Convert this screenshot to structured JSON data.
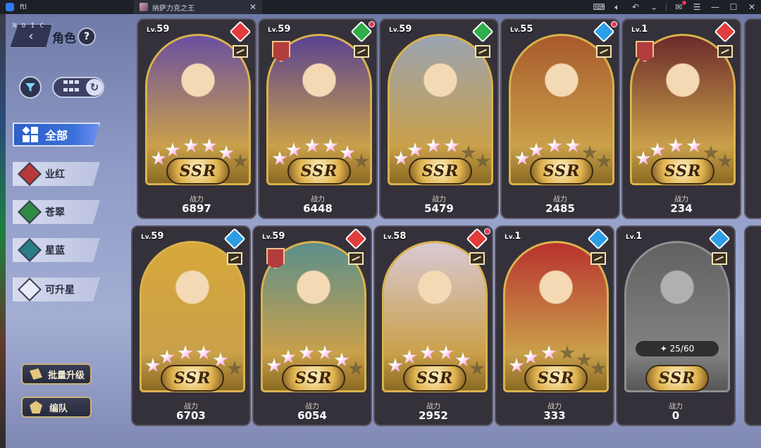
{
  "titlebar": {
    "tab1_label": "ftl",
    "tab2_label": "纳萨力克之王",
    "close_glyph": "✕"
  },
  "sidebar": {
    "back_deco": "N O I C",
    "title": "角色",
    "help": "?",
    "categories": [
      {
        "label": "全部",
        "color": "#ffffff"
      },
      {
        "label": "业红",
        "color": "#b63a3a"
      },
      {
        "label": "苍翠",
        "color": "#2f8a43"
      },
      {
        "label": "星蓝",
        "color": "#2a7c86"
      },
      {
        "label": "可升星",
        "color": "#3b3f55"
      }
    ],
    "batch_upgrade": "批量升级",
    "formation": "编队"
  },
  "cards": [
    {
      "lv": "59",
      "power_label": "战力",
      "power": "6897",
      "element": "#e23c3c",
      "stars_on": 5,
      "red_dot": false,
      "faction": false,
      "bg": "#6a4fa0"
    },
    {
      "lv": "59",
      "power_label": "战力",
      "power": "6448",
      "element": "#2fae4a",
      "stars_on": 5,
      "red_dot": true,
      "faction": true,
      "bg": "#5a4290"
    },
    {
      "lv": "59",
      "power_label": "战力",
      "power": "5479",
      "element": "#2fae4a",
      "stars_on": 4,
      "red_dot": false,
      "faction": false,
      "bg": "#9aa4b2"
    },
    {
      "lv": "55",
      "power_label": "战力",
      "power": "2485",
      "element": "#2c9ee6",
      "stars_on": 4,
      "red_dot": true,
      "faction": false,
      "bg": "#a85a2c"
    },
    {
      "lv": "1",
      "power_label": "战力",
      "power": "234",
      "element": "#e23c3c",
      "stars_on": 4,
      "red_dot": false,
      "faction": true,
      "bg": "#6b2a2a"
    },
    {
      "lv": "59",
      "power_label": "战力",
      "power": "6703",
      "element": "#2c9ee6",
      "stars_on": 5,
      "red_dot": false,
      "faction": false,
      "bg": "#d7a83a"
    },
    {
      "lv": "59",
      "power_label": "战力",
      "power": "6054",
      "element": "#e23c3c",
      "stars_on": 5,
      "red_dot": false,
      "faction": true,
      "bg": "#5b8f8c"
    },
    {
      "lv": "58",
      "power_label": "战力",
      "power": "2952",
      "element": "#e23c3c",
      "stars_on": 5,
      "red_dot": true,
      "faction": false,
      "bg": "#d9c9d4"
    },
    {
      "lv": "1",
      "power_label": "战力",
      "power": "333",
      "element": "#2c9ee6",
      "stars_on": 3,
      "red_dot": false,
      "faction": false,
      "bg": "#b8322e"
    },
    {
      "lv": "1",
      "power_label": "战力",
      "power": "0",
      "element": "#2c9ee6",
      "stars_on": 0,
      "red_dot": false,
      "faction": false,
      "bg": "#7a7a7a",
      "shards": "25/60",
      "locked": true
    }
  ],
  "common": {
    "lv_prefix": "Lv.",
    "rarity": "SSR"
  }
}
